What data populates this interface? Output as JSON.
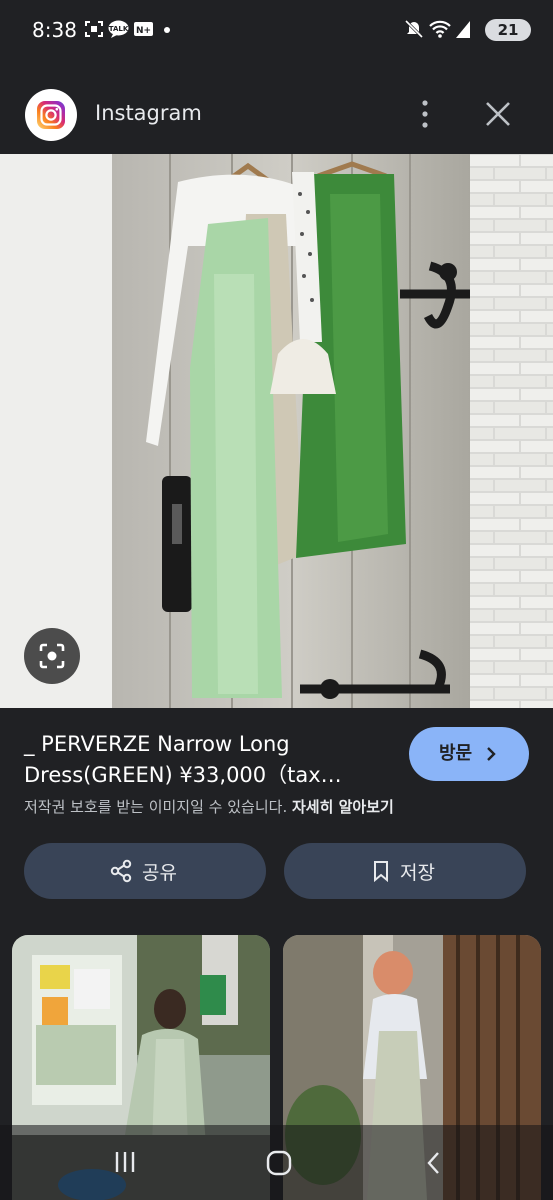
{
  "status_bar": {
    "time": "8:38",
    "battery": "21",
    "left_icons": [
      "screenshot-icon",
      "talk-icon",
      "nplus-icon",
      "dot-icon"
    ],
    "right_icons": [
      "mute-icon",
      "wifi-icon",
      "signal-icon",
      "battery-icon"
    ]
  },
  "header": {
    "app_name": "Instagram",
    "icons": [
      "instagram-logo-icon",
      "more-vert-icon",
      "close-icon"
    ]
  },
  "result": {
    "title": "_ PERVERZE Narrow Long Dress(GREEN) ¥33,000（tax…",
    "visit_label": "방문",
    "copyright_notice": "저작권 보호를 받는 이미지일 수 있습니다.",
    "learn_more": "자세히 알아보기"
  },
  "actions": {
    "share_label": "공유",
    "save_label": "저장"
  },
  "colors": {
    "background": "#202124",
    "accent": "#8ab4f8",
    "pill": "#394457"
  }
}
